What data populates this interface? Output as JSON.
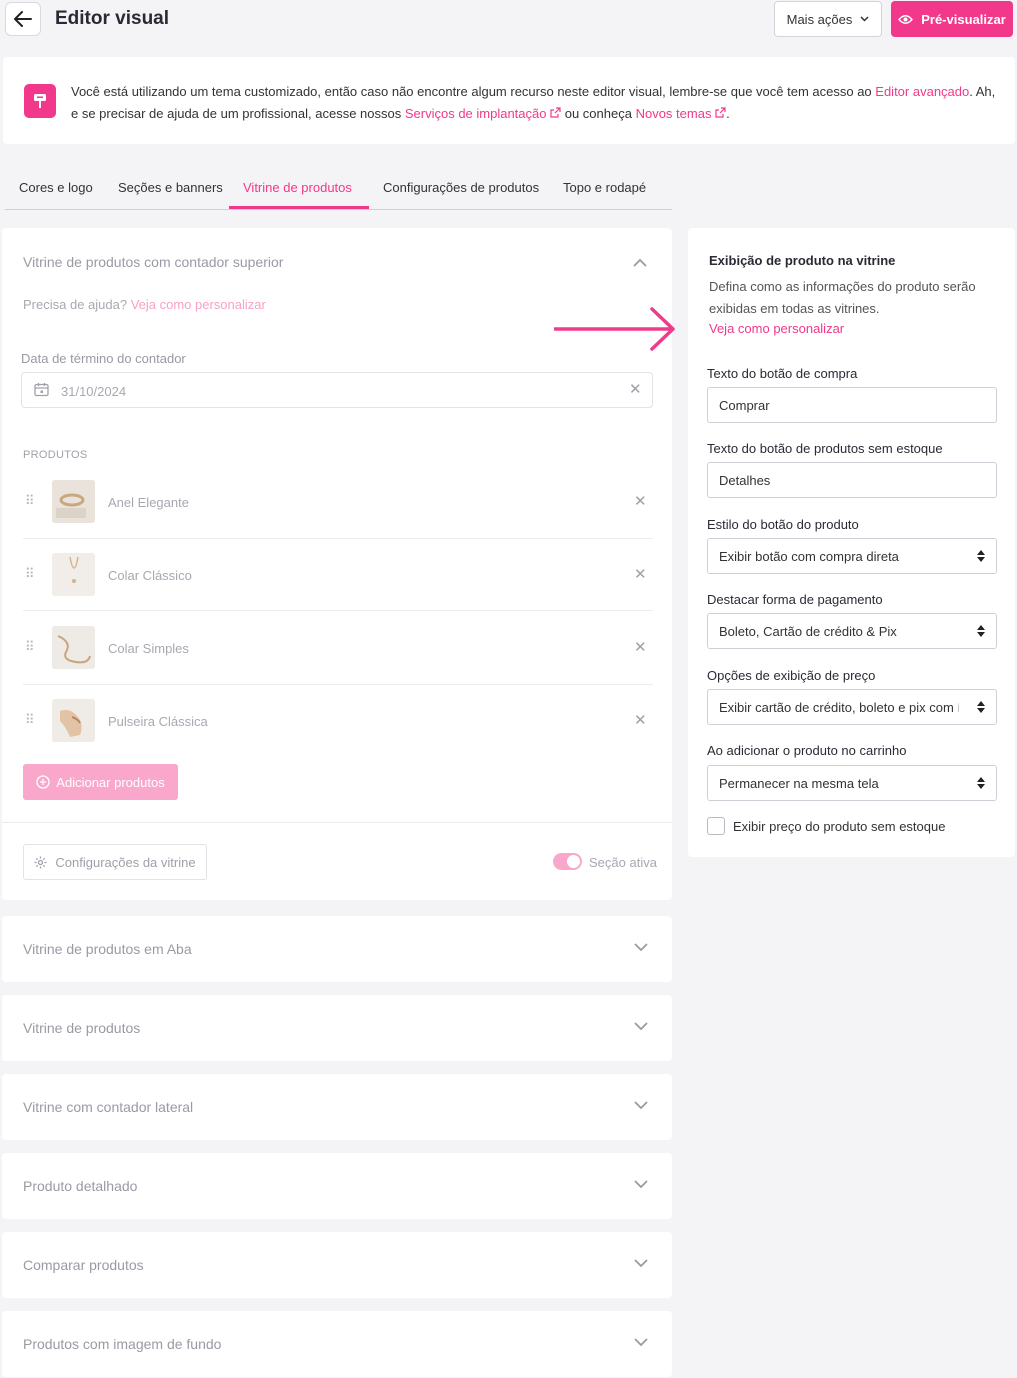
{
  "header": {
    "title": "Editor visual",
    "more_actions_label": "Mais ações",
    "preview_label": "Pré-visualizar"
  },
  "notice": {
    "text_1": "Você está utilizando um tema customizado, então caso não encontre algum recurso neste editor visual, lembre-se que você tem acesso ao ",
    "link_1": "Editor avançado",
    "text_2": ". Ah, e se precisar de ajuda de um profissional, acesse nossos ",
    "link_2": "Serviços de implantação",
    "text_3": " ou conheça ",
    "link_3": "Novos temas",
    "text_4": "."
  },
  "tabs": [
    {
      "label": "Cores e logo"
    },
    {
      "label": "Seções e banners"
    },
    {
      "label": "Vitrine de produtos"
    },
    {
      "label": "Configurações de produtos"
    },
    {
      "label": "Topo e rodapé"
    }
  ],
  "main_section": {
    "title": "Vitrine de produtos com contador superior",
    "help_text": "Precisa de ajuda?",
    "help_link": "Veja como personalizar",
    "date_label": "Data de término do contador",
    "date_value": "31/10/2024",
    "products_label": "PRODUTOS",
    "products": [
      {
        "name": "Anel Elegante"
      },
      {
        "name": "Colar Clássico"
      },
      {
        "name": "Colar Simples"
      },
      {
        "name": "Pulseira Clássica"
      }
    ],
    "add_products_label": "Adicionar produtos",
    "config_label": "Configurações da vitrine",
    "active_label": "Seção ativa",
    "active": true
  },
  "collapsed_sections": [
    {
      "title": "Vitrine de produtos em Aba"
    },
    {
      "title": "Vitrine de produtos"
    },
    {
      "title": "Vitrine com contador lateral"
    },
    {
      "title": "Produto detalhado"
    },
    {
      "title": "Comparar produtos"
    },
    {
      "title": "Produtos com imagem de fundo"
    }
  ],
  "right_panel": {
    "title": "Exibição de produto na vitrine",
    "description": "Defina como as informações do produto serão exibidas em todas as vitrines.",
    "link": "Veja como personalizar",
    "fields": {
      "buy_button_label": "Texto do botão de compra",
      "buy_button_value": "Comprar",
      "out_of_stock_label": "Texto do botão de produtos sem estoque",
      "out_of_stock_value": "Detalhes",
      "button_style_label": "Estilo do botão do produto",
      "button_style_value": "Exibir botão com compra direta",
      "payment_label": "Destacar forma de pagamento",
      "payment_value": "Boleto, Cartão de crédito & Pix",
      "price_options_label": "Opções de exibição de preço",
      "price_options_value": "Exibir cartão de crédito, boleto e pix com í",
      "cart_label": "Ao adicionar o produto no carrinho",
      "cart_value": "Permanecer na mesma tela",
      "show_price_label": "Exibir preço do produto sem estoque",
      "show_price_checked": false
    }
  },
  "colors": {
    "accent": "#f2388a",
    "accent_light": "#f9a8cb",
    "background": "#f4f4f7"
  }
}
